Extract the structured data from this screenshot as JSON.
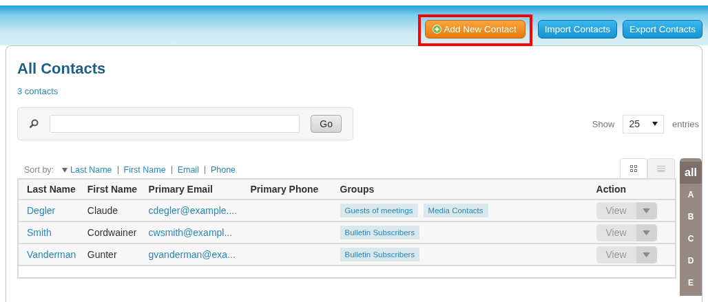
{
  "toolbar": {
    "buttons": [
      {
        "label": "Add New Contact",
        "kind": "add",
        "highlighted": true
      },
      {
        "label": "Import Contacts",
        "kind": "plain",
        "highlighted": false
      },
      {
        "label": "Export Contacts",
        "kind": "plain",
        "highlighted": false
      }
    ]
  },
  "heading": {
    "title": "All Contacts",
    "count": "3 contacts"
  },
  "search": {
    "button": "Go"
  },
  "page_size": {
    "prefix": "Show",
    "value": "25",
    "suffix": "entries"
  },
  "sort": {
    "label": "Sort by:",
    "options": [
      {
        "label": "Last Name",
        "selected": true
      },
      {
        "label": "First Name",
        "selected": false
      },
      {
        "label": "Email",
        "selected": false
      },
      {
        "label": "Phone",
        "selected": false
      }
    ]
  },
  "views": [
    {
      "kind": "grid",
      "selected": true
    },
    {
      "kind": "list",
      "selected": false
    }
  ],
  "table": {
    "columns": [
      "Last Name",
      "First Name",
      "Primary Email",
      "Primary Phone",
      "Groups",
      "Action"
    ],
    "rows": [
      {
        "last_name": "Degler",
        "first_name": "Claude",
        "email": "cdegler@example....",
        "groups": [
          "Guests of meetings",
          "Media Contacts"
        ],
        "action": "View"
      },
      {
        "last_name": "Smith",
        "first_name": "Cordwainer",
        "email": "cwsmith@exampl...",
        "groups": [
          "Bulletin Subscribers"
        ],
        "action": "View"
      },
      {
        "last_name": "Vanderman",
        "first_name": "Gunter",
        "email": "gvanderman@exa...",
        "groups": [
          "Bulletin Subscribers"
        ],
        "action": "View"
      }
    ]
  },
  "alphabet": [
    {
      "label": "all",
      "selected": true
    },
    {
      "label": "A",
      "selected": false
    },
    {
      "label": "B",
      "selected": false
    },
    {
      "label": "C",
      "selected": false
    },
    {
      "label": "D",
      "selected": false
    },
    {
      "label": "E",
      "selected": false
    }
  ]
}
